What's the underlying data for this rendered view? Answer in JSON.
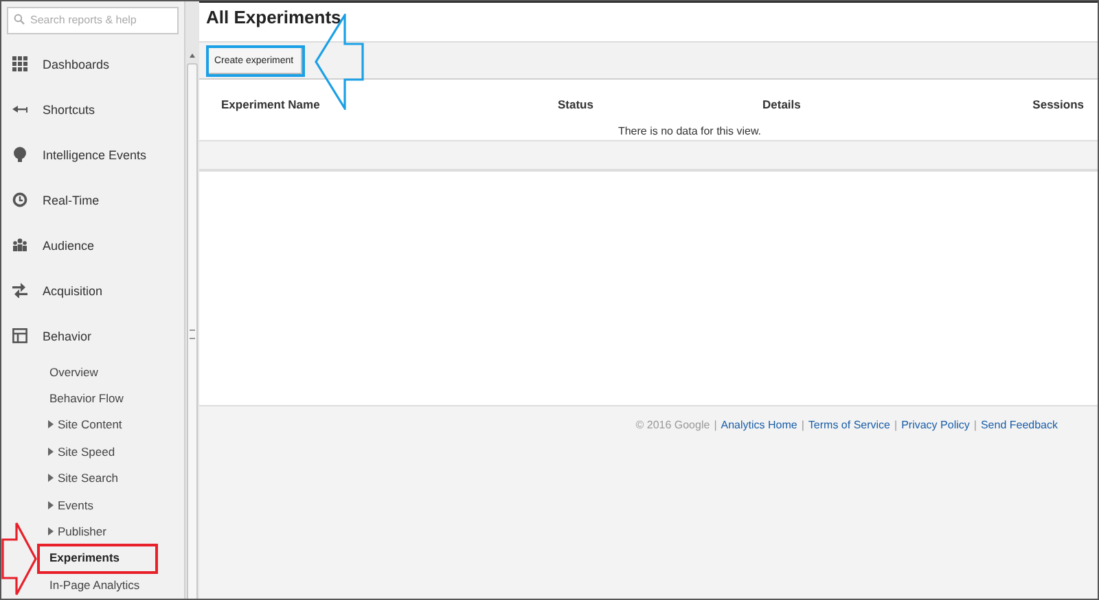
{
  "sidebar": {
    "search": {
      "placeholder": "Search reports & help"
    },
    "items": [
      {
        "label": "Dashboards",
        "selected": false
      },
      {
        "label": "Shortcuts",
        "selected": false
      },
      {
        "label": "Intelligence Events",
        "selected": false
      },
      {
        "label": "Real-Time",
        "selected": false
      },
      {
        "label": "Audience",
        "selected": false
      },
      {
        "label": "Acquisition",
        "selected": false
      },
      {
        "label": "Behavior",
        "selected": false,
        "expanded": true,
        "children": [
          {
            "label": "Overview",
            "expandable": false,
            "selected": false
          },
          {
            "label": "Behavior Flow",
            "expandable": false,
            "selected": false
          },
          {
            "label": "Site Content",
            "expandable": true,
            "selected": false
          },
          {
            "label": "Site Speed",
            "expandable": true,
            "selected": false
          },
          {
            "label": "Site Search",
            "expandable": true,
            "selected": false
          },
          {
            "label": "Events",
            "expandable": true,
            "selected": false
          },
          {
            "label": "Publisher",
            "expandable": true,
            "selected": false
          },
          {
            "label": "Experiments",
            "expandable": false,
            "selected": true,
            "highlighted": true
          },
          {
            "label": "In-Page Analytics",
            "expandable": false,
            "selected": false
          }
        ]
      }
    ]
  },
  "main": {
    "title": "All Experiments",
    "toolbar": {
      "button": {
        "label": "Create experiment",
        "highlighted": true
      }
    },
    "table": {
      "columns": [
        "Experiment Name",
        "Status",
        "Details",
        "Sessions"
      ],
      "empty_message": "There is no data for this view."
    }
  },
  "footer": {
    "copyright": "© 2016 Google",
    "separator": "|",
    "links": [
      "Analytics Home",
      "Terms of Service",
      "Privacy Policy",
      "Send Feedback"
    ]
  }
}
